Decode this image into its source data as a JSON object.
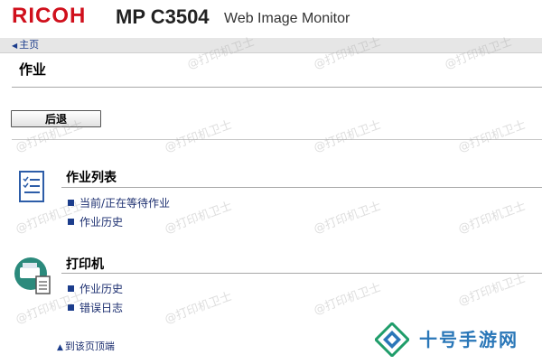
{
  "header": {
    "brand": "RICOH",
    "model": "MP C3504",
    "product": "Web Image Monitor"
  },
  "breadcrumb": {
    "home_label": "主页"
  },
  "page": {
    "title": "作业"
  },
  "back_button": {
    "label": "后退"
  },
  "sections": [
    {
      "title": "作业列表",
      "icon": "job-list-icon",
      "links": [
        "当前/正在等待作业",
        "作业历史"
      ]
    },
    {
      "title": "打印机",
      "icon": "printer-icon",
      "links": [
        "作业历史",
        "错误日志"
      ]
    }
  ],
  "footer": {
    "top_link_label": "到该页顶端"
  },
  "watermark": {
    "text": "@打印机卫士"
  },
  "corner_overlay": {
    "text": "十号手游网",
    "icon": "brand-logo-icon"
  },
  "colors": {
    "brand_red": "#d0101c",
    "link_blue": "#1c2f70",
    "bar_gray": "#e6e6e6",
    "overlay_blue": "#2a77b8"
  }
}
